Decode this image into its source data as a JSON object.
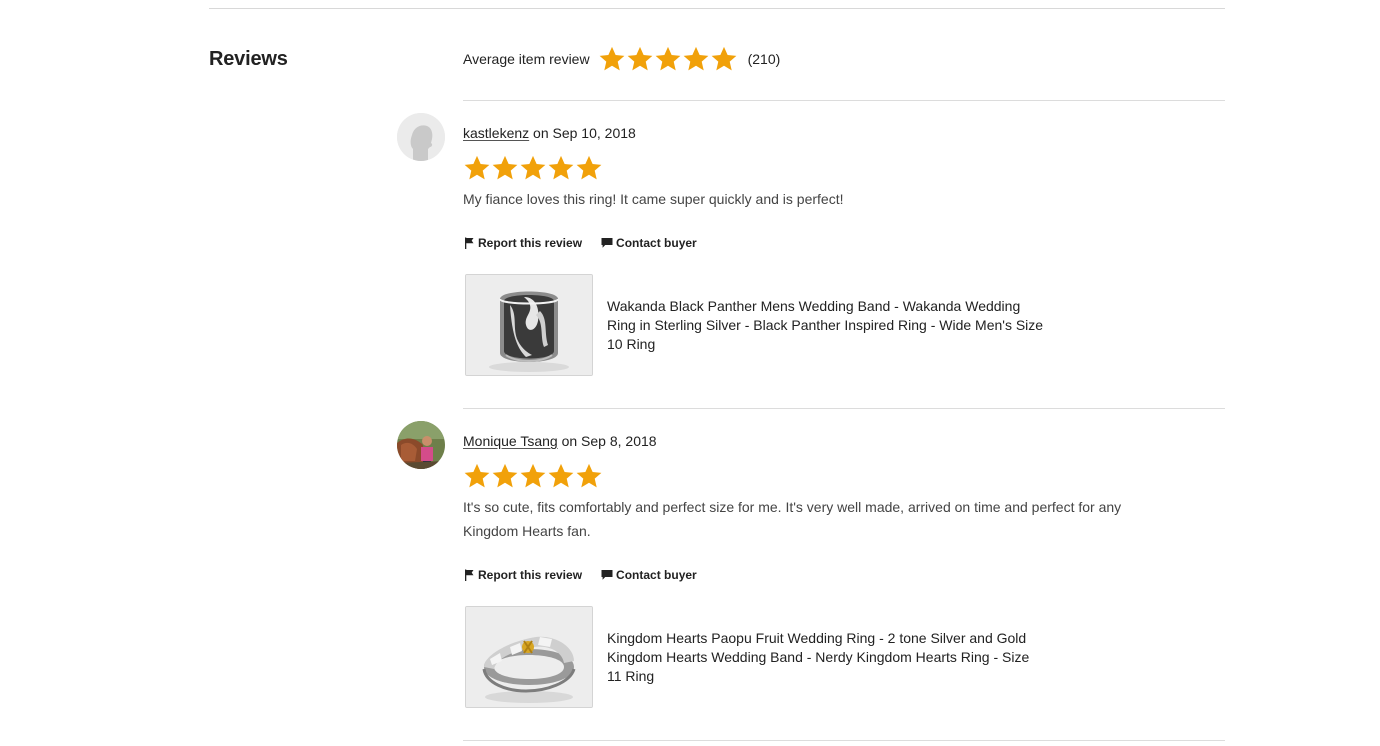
{
  "reviews_section": {
    "title": "Reviews",
    "average_label": "Average item review",
    "average_rating": 5,
    "max_rating": 5,
    "review_count_text": "(210)",
    "star_color": "#f1a10a"
  },
  "reviews": [
    {
      "author": "kastlekenz",
      "date_text": "on Sep 10, 2018",
      "rating": 5,
      "text": "My fiance loves this ring! It came super quickly and is perfect!",
      "report_label": "Report this review",
      "contact_label": "Contact buyer",
      "product_title": "Wakanda Black Panther Mens Wedding Band - Wakanda Wedding Ring in Sterling Silver - Black Panther Inspired Ring - Wide Men's Size 10 Ring"
    },
    {
      "author": "Monique Tsang",
      "date_text": "on Sep 8, 2018",
      "rating": 5,
      "text": "It's so cute, fits comfortably and perfect size for me. It's very well made, arrived on time and perfect for any Kingdom Hearts fan.",
      "report_label": "Report this review",
      "contact_label": "Contact buyer",
      "product_title": "Kingdom Hearts Paopu Fruit Wedding Ring - 2 tone Silver and Gold Kingdom Hearts Wedding Band - Nerdy Kingdom Hearts Ring - Size 11 Ring"
    }
  ]
}
